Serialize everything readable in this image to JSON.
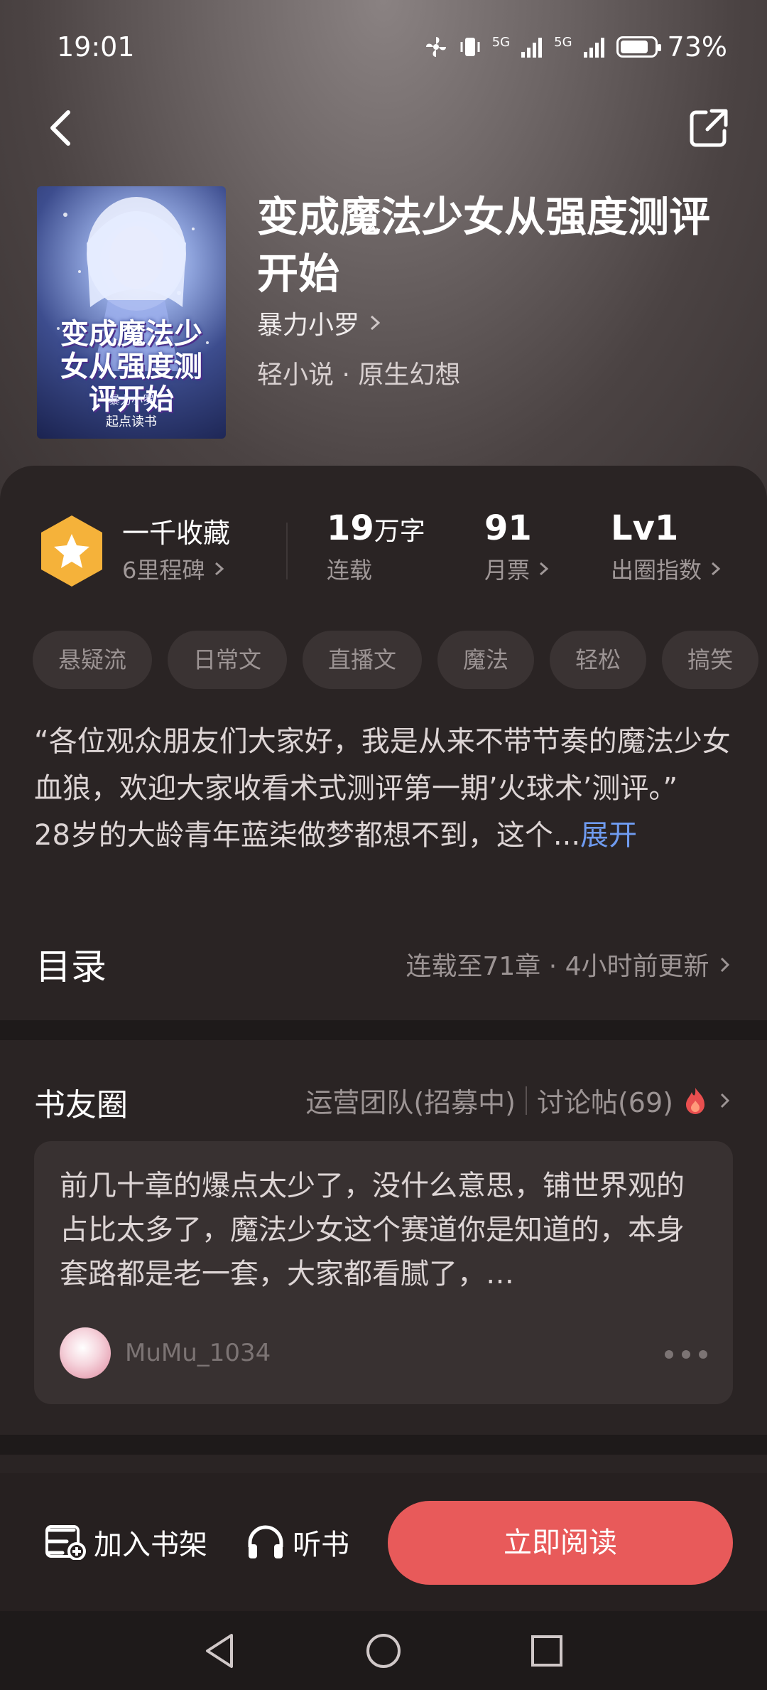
{
  "status_bar": {
    "time": "19:01",
    "signal_1": "5G",
    "signal_2": "5G",
    "battery": "73%"
  },
  "book": {
    "title": "变成魔法少女从强度测评开始",
    "author": "暴力小罗",
    "genre": "轻小说 · 原生幻想",
    "cover": {
      "title": "变成魔法少女从强度测评开始",
      "author": "暴力小罗",
      "brand": "起点读书"
    }
  },
  "stats": {
    "collection_title": "一千收藏",
    "collection_sub": "6里程碑",
    "words_value": "19",
    "words_unit": "万字",
    "words_label": "连载",
    "tickets_value": "91",
    "tickets_label": "月票",
    "level_value": "Lv1",
    "level_label": "出圈指数"
  },
  "tags": [
    "悬疑流",
    "日常文",
    "直播文",
    "魔法",
    "轻松",
    "搞笑"
  ],
  "description": {
    "text": "“各位观众朋友们大家好，我是从来不带节奏的魔法少女血狼，欢迎大家收看术式测评第一期’火球术’测评。”\n28岁的大龄青年蓝柒做梦都想不到，这个...",
    "more": "展开"
  },
  "toc": {
    "title": "目录",
    "info": "连载至71章 · 4小时前更新"
  },
  "circle": {
    "title": "书友圈",
    "ops_link": "运营团队(招募中)",
    "discuss_link": "讨论帖(69)",
    "post": {
      "text": "前几十章的爆点太少了，没什么意思，铺世界观的占比太多了，魔法少女这个赛道你是知道的，本身套路都是老一套，大家都看腻了，…",
      "username": "MuMu_1034"
    }
  },
  "bottom": {
    "shelf": "加入书架",
    "listen": "听书",
    "read": "立即阅读"
  },
  "colors": {
    "accent": "#e85a5a",
    "link": "#6f9bf0",
    "badge": "#f5b23a"
  }
}
